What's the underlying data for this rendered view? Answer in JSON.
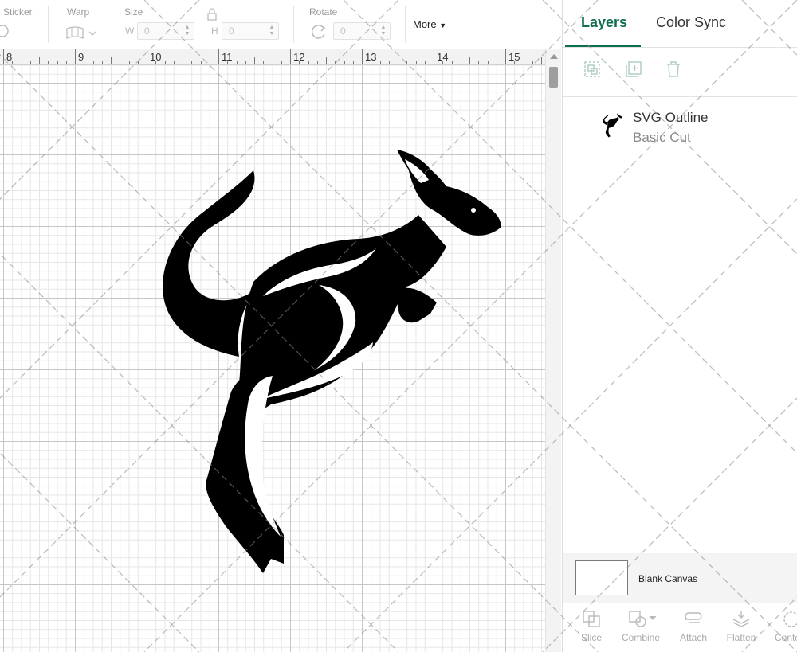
{
  "toolbar": {
    "sticker_label": "Sticker",
    "warp_label": "Warp",
    "size_label": "Size",
    "width_letter": "W",
    "width_value": "0",
    "height_letter": "H",
    "height_value": "0",
    "rotate_label": "Rotate",
    "rotate_value": "0",
    "more_label": "More"
  },
  "ruler": {
    "numbers": [
      "8",
      "9",
      "10",
      "11",
      "12",
      "13",
      "14",
      "15"
    ]
  },
  "panel": {
    "tabs": [
      {
        "label": "Layers",
        "active": true
      },
      {
        "label": "Color Sync",
        "active": false
      }
    ],
    "layer": {
      "name": "SVG Outline",
      "operation": "Basic Cut",
      "icon": "kangaroo-icon"
    },
    "blank_canvas_label": "Blank Canvas",
    "bottom_tools": [
      {
        "label": "Slice",
        "icon": "slice-icon"
      },
      {
        "label": "Combine",
        "icon": "combine-icon"
      },
      {
        "label": "Attach",
        "icon": "attach-icon"
      },
      {
        "label": "Flatten",
        "icon": "flatten-icon"
      },
      {
        "label": "Conto",
        "icon": "contour-icon"
      }
    ]
  },
  "colors": {
    "accent": "#0f6e4f",
    "artwork": "#000000"
  }
}
